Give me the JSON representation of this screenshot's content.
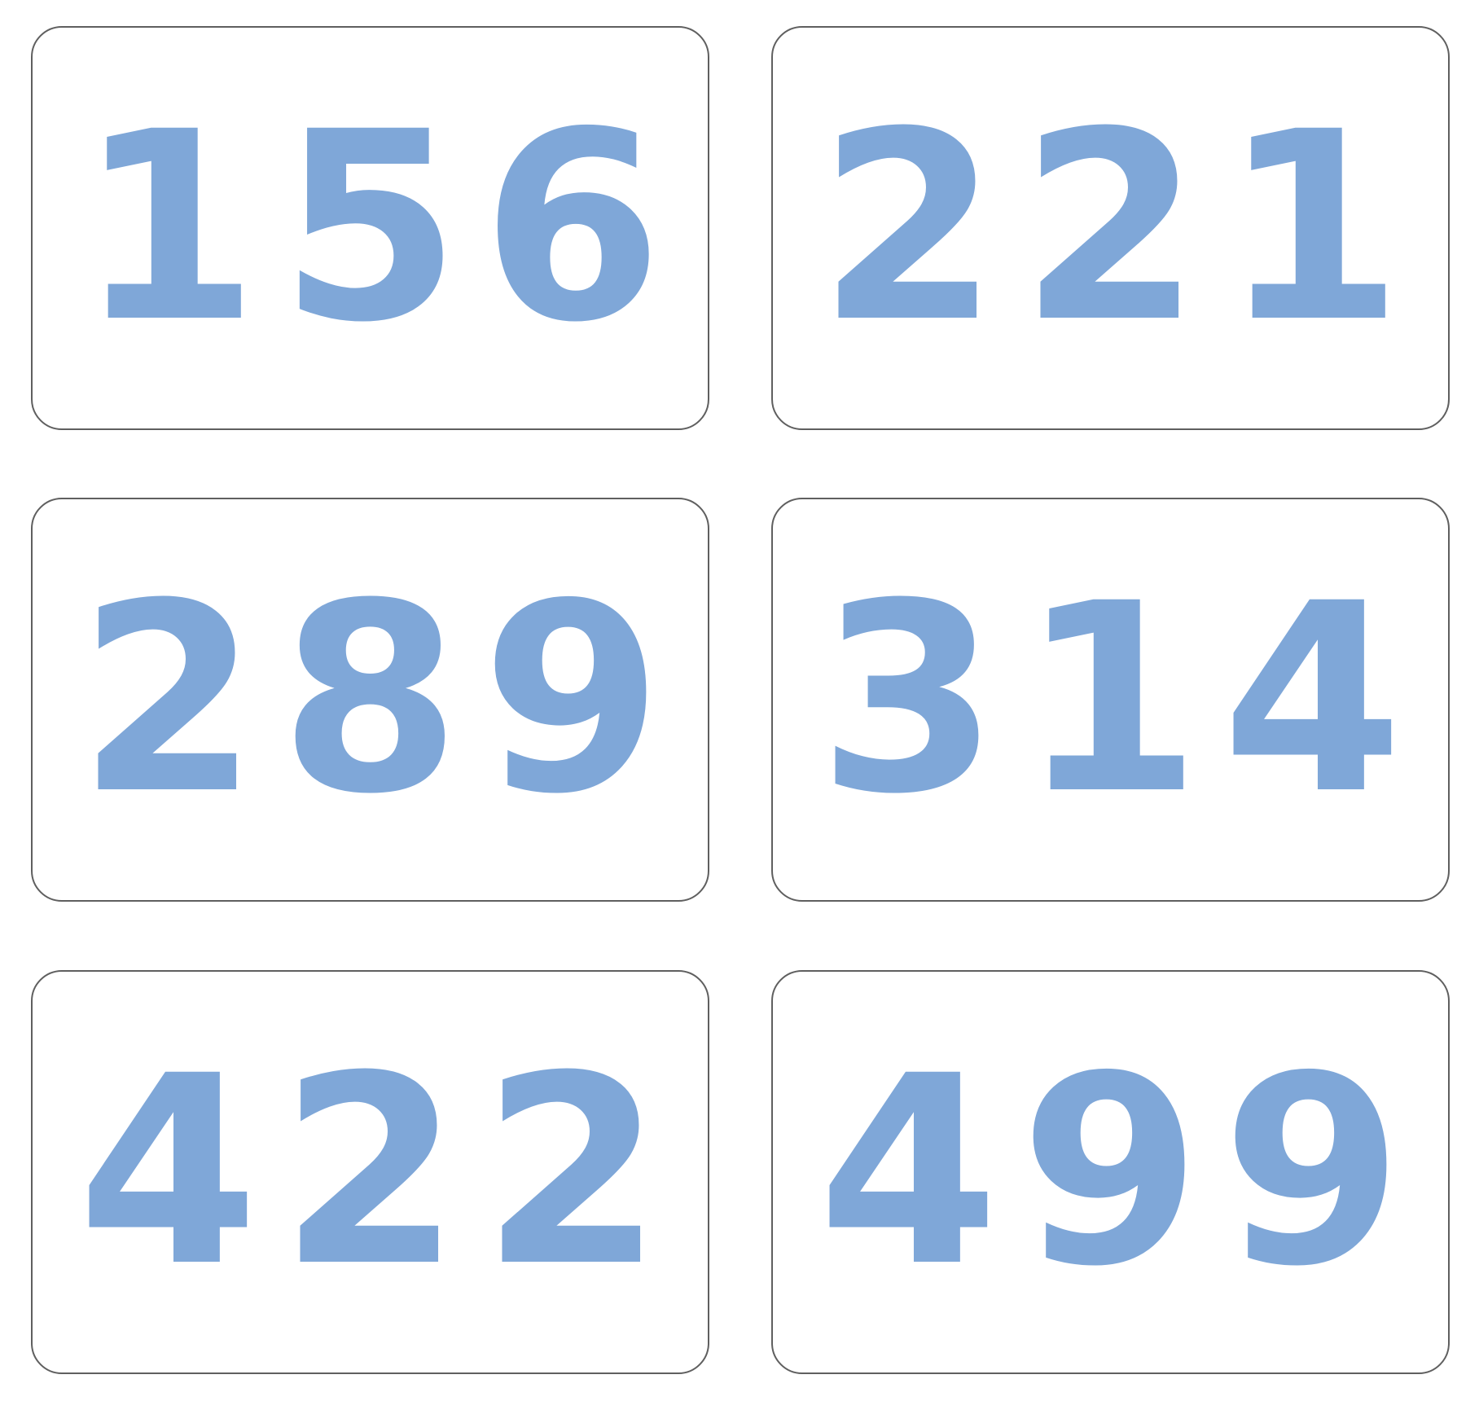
{
  "accent_color": "#7fa7d8",
  "cards": [
    {
      "digits": [
        "1",
        "5",
        "6"
      ]
    },
    {
      "digits": [
        "2",
        "2",
        "1"
      ]
    },
    {
      "digits": [
        "2",
        "8",
        "9"
      ]
    },
    {
      "digits": [
        "3",
        "1",
        "4"
      ]
    },
    {
      "digits": [
        "4",
        "2",
        "2"
      ]
    },
    {
      "digits": [
        "4",
        "9",
        "9"
      ]
    }
  ]
}
